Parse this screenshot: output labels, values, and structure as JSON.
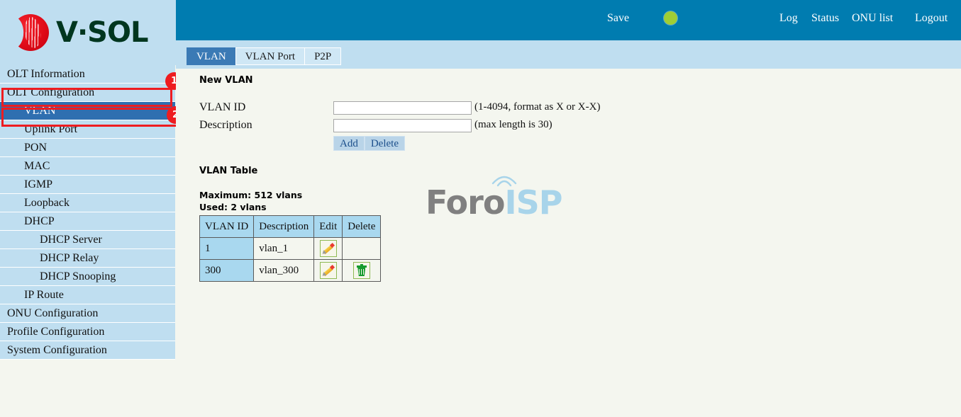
{
  "brand": {
    "logo_text": "V·SOL",
    "logo_icon": "vsol-circle-logo"
  },
  "header": {
    "save_label": "Save",
    "indicator_icon": "status-indicator-green",
    "indicator_color": "#9fce35",
    "links": {
      "log": "Log",
      "status": "Status",
      "onu_list": "ONU list",
      "logout": "Logout"
    },
    "background_color": "#007cb0"
  },
  "tabs": [
    {
      "label": "VLAN",
      "active": true
    },
    {
      "label": "VLAN Port",
      "active": false
    },
    {
      "label": "P2P",
      "active": false
    }
  ],
  "sidebar": {
    "items": [
      {
        "label": "OLT Information",
        "level": 0,
        "selected": false
      },
      {
        "label": "OLT Configuration",
        "level": 0,
        "selected": false
      },
      {
        "label": "VLAN",
        "level": 1,
        "selected": true
      },
      {
        "label": "Uplink Port",
        "level": 1,
        "selected": false
      },
      {
        "label": "PON",
        "level": 1,
        "selected": false
      },
      {
        "label": "MAC",
        "level": 1,
        "selected": false
      },
      {
        "label": "IGMP",
        "level": 1,
        "selected": false
      },
      {
        "label": "Loopback",
        "level": 1,
        "selected": false
      },
      {
        "label": "DHCP",
        "level": 1,
        "selected": false
      },
      {
        "label": "DHCP Server",
        "level": 2,
        "selected": false
      },
      {
        "label": "DHCP Relay",
        "level": 2,
        "selected": false
      },
      {
        "label": "DHCP Snooping",
        "level": 2,
        "selected": false
      },
      {
        "label": "IP Route",
        "level": 1,
        "selected": false
      },
      {
        "label": "ONU Configuration",
        "level": 0,
        "selected": false
      },
      {
        "label": "Profile Configuration",
        "level": 0,
        "selected": false
      },
      {
        "label": "System Configuration",
        "level": 0,
        "selected": false
      }
    ]
  },
  "annotations": {
    "color": "#ee1c20",
    "badges": [
      {
        "number": "1",
        "target": "OLT Configuration"
      },
      {
        "number": "2",
        "target": "VLAN"
      }
    ]
  },
  "main": {
    "new_vlan": {
      "title": "New VLAN",
      "vlan_id_label": "VLAN ID",
      "vlan_id_value": "",
      "vlan_id_hint": "(1-4094, format as X or X-X)",
      "description_label": "Description",
      "description_value": "",
      "description_hint": "(max length is 30)",
      "add_label": "Add",
      "delete_label": "Delete"
    },
    "vlan_table": {
      "title": "VLAN Table",
      "maximum_line": "Maximum: 512 vlans",
      "used_line": "Used: 2 vlans",
      "columns": [
        "VLAN ID",
        "Description",
        "Edit",
        "Delete"
      ],
      "rows": [
        {
          "vlan_id": "1",
          "description": "vlan_1",
          "edit_icon": "pencil-edit-icon",
          "delete_icon": ""
        },
        {
          "vlan_id": "300",
          "description": "vlan_300",
          "edit_icon": "pencil-edit-icon",
          "delete_icon": "trash-delete-icon"
        }
      ]
    }
  },
  "watermark": {
    "part1": "Foro",
    "part2": "ISP",
    "color1": "#808080",
    "color2": "#a8d4ea"
  }
}
